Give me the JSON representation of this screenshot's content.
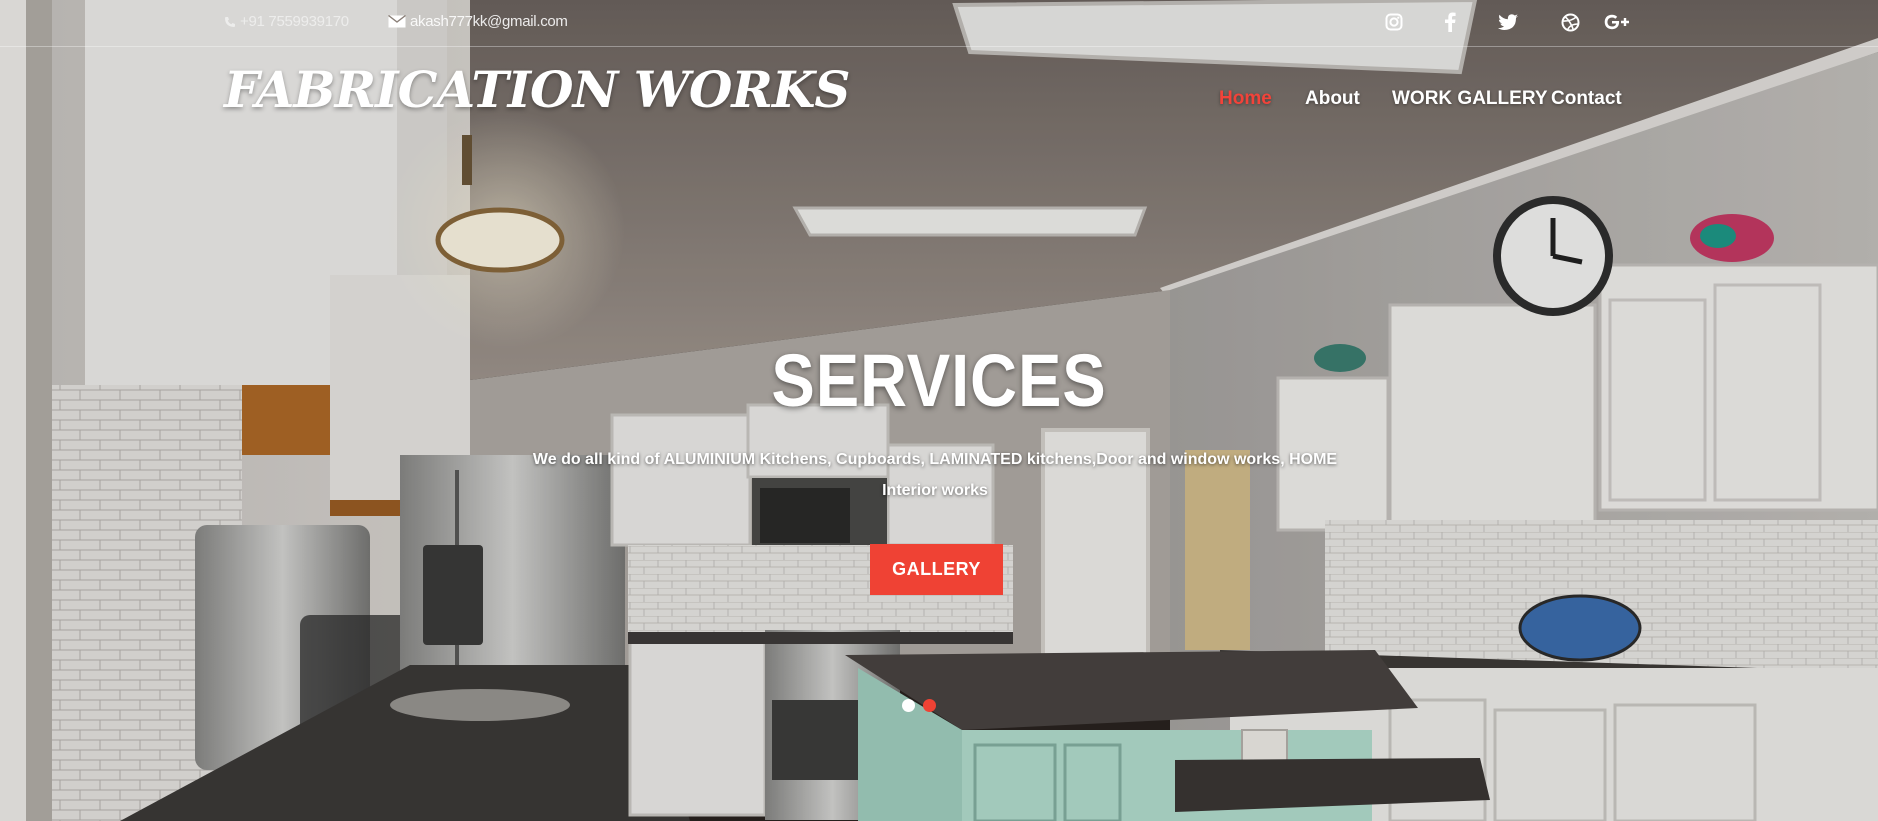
{
  "topbar": {
    "phone": "+91 7559939170",
    "email": "akash777kk@gmail.com",
    "social": [
      "instagram-icon",
      "facebook-icon",
      "twitter-icon",
      "dribbble-icon",
      "google-plus-icon"
    ]
  },
  "brand": {
    "name": "FABRICATION WORKS"
  },
  "nav": {
    "items": [
      {
        "label": "Home",
        "active": true
      },
      {
        "label": "About",
        "active": false
      },
      {
        "label": "WORK GALLERY",
        "active": false
      },
      {
        "label": "Contact",
        "active": false
      }
    ]
  },
  "hero": {
    "title": "SERVICES",
    "subtitle": "We do all kind of ALUMINIUM Kitchens, Cupboards, LAMINATED kitchens,Door and window works, HOME Interior works",
    "button_label": "GALLERY",
    "slide_count": 2,
    "active_slide": 2
  },
  "colors": {
    "accent": "#ef4234",
    "text": "#ffffff"
  }
}
